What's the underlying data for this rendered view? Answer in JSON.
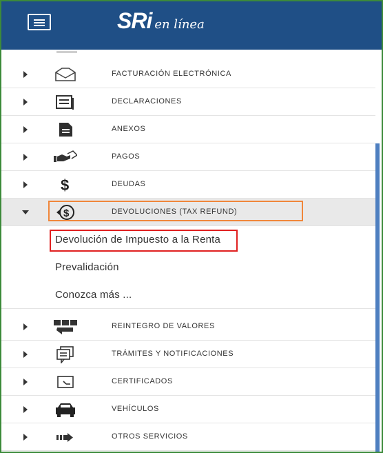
{
  "header": {
    "logo_main": "SRi",
    "logo_sub": "en línea",
    "menu_button": "menu"
  },
  "colors": {
    "header_bg": "#1f4f86",
    "highlight_orange": "#f0863a",
    "highlight_red": "#e02020",
    "scrollbar": "#4e7fc0"
  },
  "menu": {
    "items": [
      {
        "label": "FACTURACIÓN ELECTRÓNICA",
        "icon": "envelope-icon"
      },
      {
        "label": "DECLARACIONES",
        "icon": "document-list-icon"
      },
      {
        "label": "ANEXOS",
        "icon": "file-icon"
      },
      {
        "label": "PAGOS",
        "icon": "hand-payment-icon"
      },
      {
        "label": "DEUDAS",
        "icon": "dollar-icon"
      },
      {
        "label": "DEVOLUCIONES (TAX REFUND)",
        "icon": "dollar-circle-icon"
      },
      {
        "label": "REINTEGRO DE VALORES",
        "icon": "money-return-icon"
      },
      {
        "label": "TRÁMITES Y NOTIFICACIONES",
        "icon": "notification-icon"
      },
      {
        "label": "CERTIFICADOS",
        "icon": "certificate-icon"
      },
      {
        "label": "VEHÍCULOS",
        "icon": "car-icon"
      },
      {
        "label": "OTROS SERVICIOS",
        "icon": "arrow-services-icon"
      }
    ],
    "submenu": [
      {
        "label": "Devolución de Impuesto a la Renta"
      },
      {
        "label": "Prevalidación"
      },
      {
        "label": "Conozca más ..."
      }
    ]
  }
}
